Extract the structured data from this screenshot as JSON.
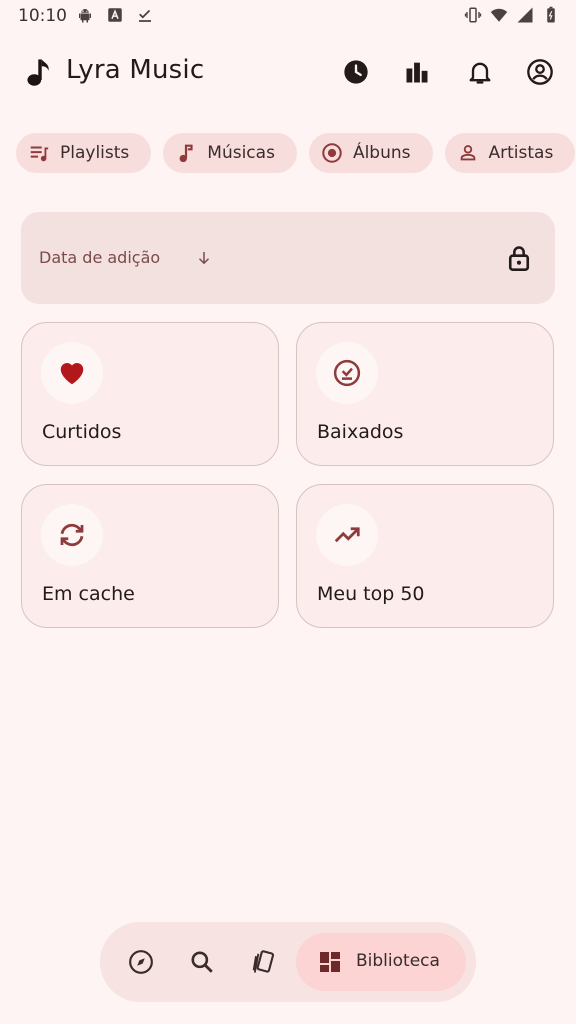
{
  "status": {
    "time": "10:10",
    "left_icons": [
      "android-icon",
      "text-a-icon",
      "download-check-icon"
    ],
    "right_icons": [
      "vibrate-icon",
      "wifi-icon",
      "signal-icon",
      "battery-icon"
    ]
  },
  "header": {
    "title": "Lyra Music",
    "actions": [
      "history-icon",
      "stats-icon",
      "notifications-icon",
      "account-icon"
    ]
  },
  "chips": [
    {
      "label": "Playlists",
      "icon": "playlist-icon"
    },
    {
      "label": "Músicas",
      "icon": "music-note-icon"
    },
    {
      "label": "Álbuns",
      "icon": "album-icon"
    },
    {
      "label": "Artistas",
      "icon": "person-icon"
    }
  ],
  "sort": {
    "label": "Data de adição",
    "direction_icon": "arrow-down-icon",
    "lock_icon": "lock-icon"
  },
  "cards": [
    {
      "label": "Curtidos",
      "icon": "heart-icon"
    },
    {
      "label": "Baixados",
      "icon": "downloaded-icon"
    },
    {
      "label": "Em cache",
      "icon": "cache-sync-icon"
    },
    {
      "label": "Meu top 50",
      "icon": "trending-up-icon"
    }
  ],
  "bottom_nav": {
    "items": [
      "explore-icon",
      "search-icon",
      "swipe-cards-icon"
    ],
    "active_label": "Biblioteca",
    "active_icon": "library-icon"
  },
  "colors": {
    "background": "#fdf4f3",
    "accent": "#8f3b3b",
    "heart": "#b3171c",
    "chip": "#f7dedd",
    "active_nav": "#fbd4d3"
  }
}
